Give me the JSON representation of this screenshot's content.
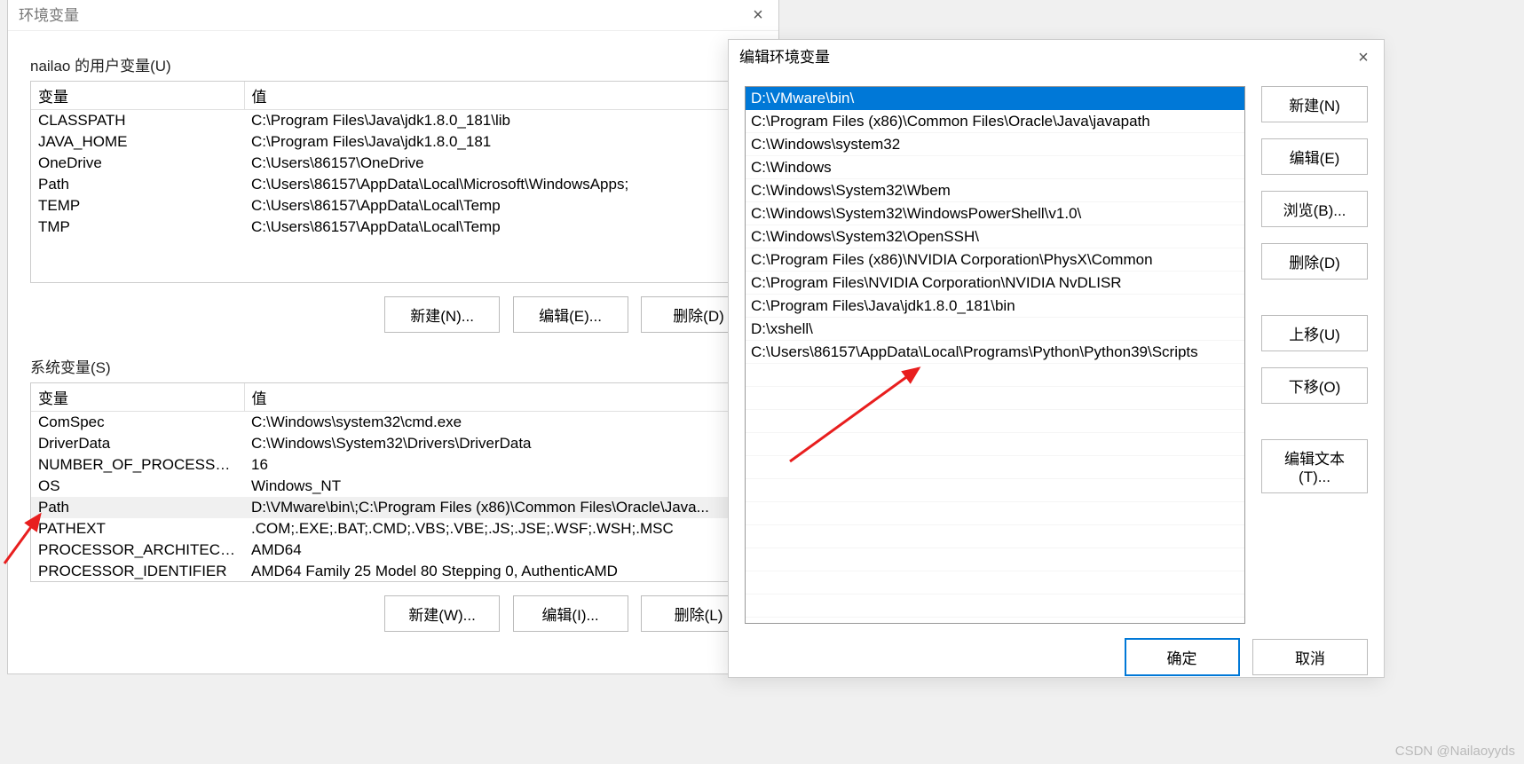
{
  "envWindow": {
    "title": "环境变量",
    "close": "×",
    "userSection": {
      "label": "nailao 的用户变量(U)",
      "headers": {
        "name": "变量",
        "value": "值"
      },
      "rows": [
        {
          "name": "CLASSPATH",
          "value": "C:\\Program Files\\Java\\jdk1.8.0_181\\lib"
        },
        {
          "name": "JAVA_HOME",
          "value": "C:\\Program Files\\Java\\jdk1.8.0_181"
        },
        {
          "name": "OneDrive",
          "value": "C:\\Users\\86157\\OneDrive"
        },
        {
          "name": "Path",
          "value": "C:\\Users\\86157\\AppData\\Local\\Microsoft\\WindowsApps;"
        },
        {
          "name": "TEMP",
          "value": "C:\\Users\\86157\\AppData\\Local\\Temp"
        },
        {
          "name": "TMP",
          "value": "C:\\Users\\86157\\AppData\\Local\\Temp"
        }
      ],
      "buttons": {
        "new": "新建(N)...",
        "edit": "编辑(E)...",
        "delete": "删除(D)"
      }
    },
    "sysSection": {
      "label": "系统变量(S)",
      "headers": {
        "name": "变量",
        "value": "值"
      },
      "rows": [
        {
          "name": "ComSpec",
          "value": "C:\\Windows\\system32\\cmd.exe",
          "selected": false
        },
        {
          "name": "DriverData",
          "value": "C:\\Windows\\System32\\Drivers\\DriverData",
          "selected": false
        },
        {
          "name": "NUMBER_OF_PROCESSORS",
          "value": "16",
          "selected": false
        },
        {
          "name": "OS",
          "value": "Windows_NT",
          "selected": false
        },
        {
          "name": "Path",
          "value": "D:\\VMware\\bin\\;C:\\Program Files (x86)\\Common Files\\Oracle\\Java...",
          "selected": true
        },
        {
          "name": "PATHEXT",
          "value": ".COM;.EXE;.BAT;.CMD;.VBS;.VBE;.JS;.JSE;.WSF;.WSH;.MSC",
          "selected": false
        },
        {
          "name": "PROCESSOR_ARCHITECTURE",
          "value": "AMD64",
          "selected": false
        },
        {
          "name": "PROCESSOR_IDENTIFIER",
          "value": "AMD64 Family 25 Model 80 Stepping 0, AuthenticAMD",
          "selected": false
        }
      ],
      "buttons": {
        "new": "新建(W)...",
        "edit": "编辑(I)...",
        "delete": "删除(L)"
      }
    }
  },
  "editWindow": {
    "title": "编辑环境变量",
    "close": "×",
    "entries": [
      {
        "path": "D:\\VMware\\bin\\",
        "selected": true
      },
      {
        "path": "C:\\Program Files (x86)\\Common Files\\Oracle\\Java\\javapath"
      },
      {
        "path": "C:\\Windows\\system32"
      },
      {
        "path": "C:\\Windows"
      },
      {
        "path": "C:\\Windows\\System32\\Wbem"
      },
      {
        "path": "C:\\Windows\\System32\\WindowsPowerShell\\v1.0\\"
      },
      {
        "path": "C:\\Windows\\System32\\OpenSSH\\"
      },
      {
        "path": "C:\\Program Files (x86)\\NVIDIA Corporation\\PhysX\\Common"
      },
      {
        "path": "C:\\Program Files\\NVIDIA Corporation\\NVIDIA NvDLISR"
      },
      {
        "path": "C:\\Program Files\\Java\\jdk1.8.0_181\\bin"
      },
      {
        "path": "D:\\xshell\\"
      },
      {
        "path": "C:\\Users\\86157\\AppData\\Local\\Programs\\Python\\Python39\\Scripts"
      }
    ],
    "buttons": {
      "new": "新建(N)",
      "edit": "编辑(E)",
      "browse": "浏览(B)...",
      "delete": "删除(D)",
      "moveUp": "上移(U)",
      "moveDown": "下移(O)",
      "editText": "编辑文本(T)...",
      "ok": "确定",
      "cancel": "取消"
    }
  },
  "watermark": "CSDN @Nailaoyyds"
}
